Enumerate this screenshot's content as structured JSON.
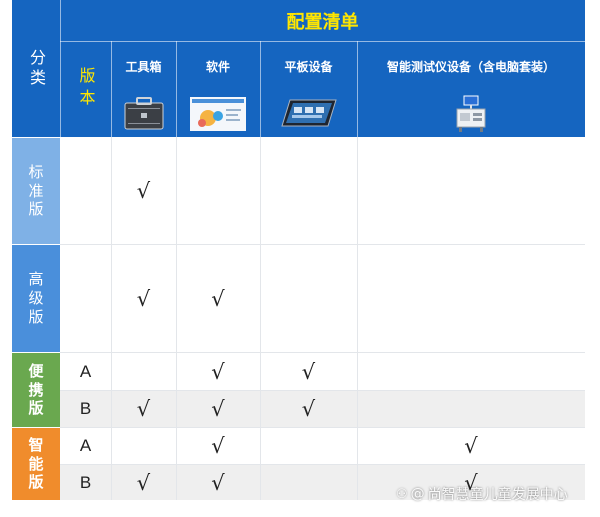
{
  "table": {
    "header": {
      "category_label": "分类",
      "config_title": "配置清单",
      "version_label": "版本",
      "columns": [
        {
          "label": "工具箱",
          "icon": "toolbox-icon"
        },
        {
          "label": "软件",
          "icon": "software-screen-icon"
        },
        {
          "label": "平板设备",
          "icon": "tablet-icon"
        },
        {
          "label": "智能测试仪设备（含电脑套装）",
          "icon": "test-instrument-icon"
        }
      ]
    },
    "groups": [
      {
        "name": "标准版",
        "chars": [
          "标",
          "准",
          "版"
        ],
        "color": "#7fb1e6"
      },
      {
        "name": "高级版",
        "chars": [
          "高",
          "级",
          "版"
        ],
        "color": "#4a8fdb"
      },
      {
        "name": "便携版",
        "chars": [
          "便",
          "携",
          "版"
        ],
        "color": "#6aa84f"
      },
      {
        "name": "智能版",
        "chars": [
          "智",
          "能",
          "版"
        ],
        "color": "#f08c2c"
      }
    ],
    "check_mark": "√",
    "rows": [
      {
        "group": 0,
        "version": "",
        "checks": [
          true,
          false,
          false,
          false
        ]
      },
      {
        "group": 1,
        "version": "",
        "checks": [
          true,
          true,
          false,
          false
        ]
      },
      {
        "group": 2,
        "version": "A",
        "checks": [
          false,
          true,
          true,
          false
        ]
      },
      {
        "group": 2,
        "version": "B",
        "checks": [
          true,
          true,
          true,
          false
        ]
      },
      {
        "group": 3,
        "version": "A",
        "checks": [
          false,
          true,
          false,
          true
        ]
      },
      {
        "group": 3,
        "version": "B",
        "checks": [
          true,
          true,
          false,
          true
        ]
      }
    ]
  },
  "watermark": {
    "text": "尚智慧童儿童发展中心"
  }
}
